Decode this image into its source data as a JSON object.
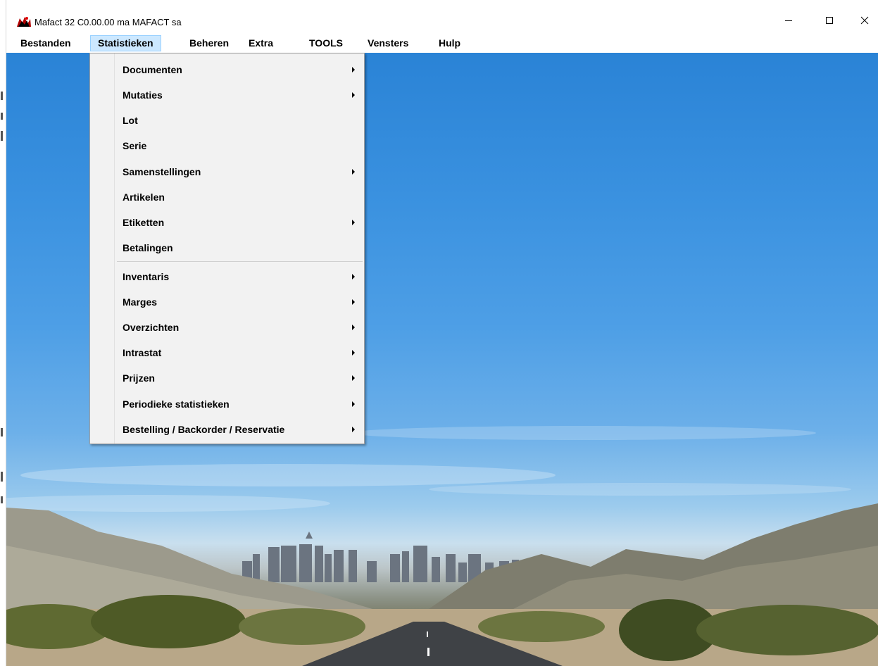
{
  "window": {
    "title": "Mafact 32 C0.00.00  ma MAFACT sa",
    "app_icon": "mafact-logo-icon",
    "controls": {
      "minimize": "minimize-icon",
      "maximize": "maximize-icon",
      "close": "close-icon"
    }
  },
  "menubar": {
    "items": [
      {
        "label": "Bestanden"
      },
      {
        "label": "Statistieken",
        "open": true
      },
      {
        "label": "Beheren"
      },
      {
        "label": "Extra"
      },
      {
        "label": "TOOLS"
      },
      {
        "label": "Vensters"
      },
      {
        "label": "Hulp"
      }
    ]
  },
  "dropdown": {
    "menu": "Statistieken",
    "items": [
      {
        "label": "Documenten",
        "submenu": true
      },
      {
        "label": "Mutaties",
        "submenu": true
      },
      {
        "label": "Lot",
        "submenu": false
      },
      {
        "label": "Serie",
        "submenu": false
      },
      {
        "label": "Samenstellingen",
        "submenu": true
      },
      {
        "label": "Artikelen",
        "submenu": false
      },
      {
        "label": "Etiketten",
        "submenu": true
      },
      {
        "label": "Betalingen",
        "submenu": false
      },
      {
        "label": "Inventaris",
        "submenu": true
      },
      {
        "label": "Marges",
        "submenu": true
      },
      {
        "label": "Overzichten",
        "submenu": true
      },
      {
        "label": "Intrastat",
        "submenu": true
      },
      {
        "label": "Prijzen",
        "submenu": true
      },
      {
        "label": "Periodieke statistieken",
        "submenu": true
      },
      {
        "label": "Bestelling / Backorder / Reservatie",
        "submenu": true
      }
    ]
  },
  "colors": {
    "menu_highlight": "#cce8ff",
    "menu_highlight_border": "#99d1ff",
    "dropdown_bg": "#f2f2f2",
    "sky_top": "#2a83d6"
  }
}
